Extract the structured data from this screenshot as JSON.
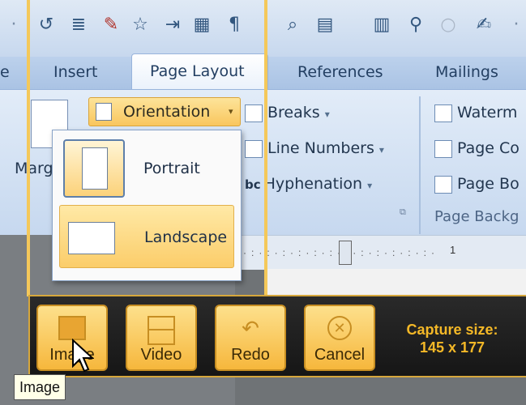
{
  "ribbon": {
    "tabs": {
      "left_partial": "e",
      "insert": "Insert",
      "page_layout": "Page Layout",
      "references": "References",
      "mailings": "Mailings"
    },
    "margins_label": "Marg",
    "orientation_label": "Orientation",
    "breaks_label": "Breaks",
    "line_numbers_label": "Line Numbers",
    "hyphenation_label": "Hyphenation",
    "watermark_label": "Waterm",
    "page_color_label": "Page Co",
    "page_borders_label": "Page Bo",
    "page_background_group": "Page Backg",
    "hyphen_icon_text": "bc"
  },
  "orientation_menu": {
    "portrait": "Portrait",
    "landscape": "Landscape",
    "selected": "Landscape"
  },
  "ruler": {
    "marker": "1"
  },
  "capture_bar": {
    "image_label": "Image",
    "video_label": "Video",
    "redo_label": "Redo",
    "cancel_label": "Cancel",
    "capture_size_label": "Capture size:",
    "capture_size_value": "145 x 177"
  },
  "tooltip": "Image",
  "colors": {
    "capture_accent": "#f4b827",
    "button_fill": "#f6b73c",
    "ribbon_blue": "#c6d8ef"
  }
}
